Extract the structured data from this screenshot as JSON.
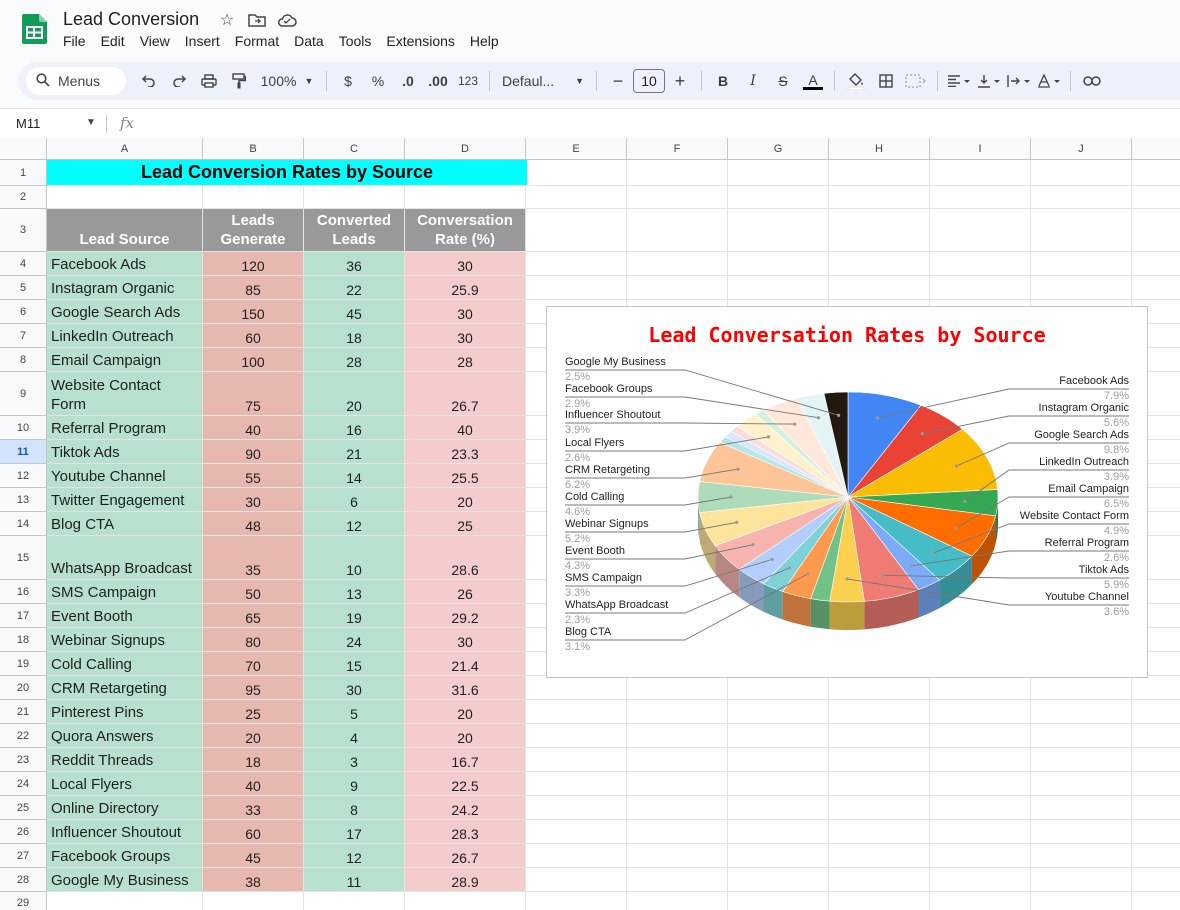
{
  "app": {
    "doc_title": "Lead Conversion",
    "menu": [
      "File",
      "Edit",
      "View",
      "Insert",
      "Format",
      "Data",
      "Tools",
      "Extensions",
      "Help"
    ]
  },
  "toolbar": {
    "search_label": "Menus",
    "zoom": "100%",
    "currency": "$",
    "percent": "%",
    "dec_decrease": ".0",
    "dec_increase": ".00",
    "number_format": "123",
    "font": "Defaul...",
    "font_size": "10",
    "bold": "B",
    "italic": "I",
    "strike": "S",
    "text_color": "A"
  },
  "formula_bar": {
    "cell_ref": "M11",
    "fx": "fx"
  },
  "grid": {
    "columns": [
      "A",
      "B",
      "C",
      "D",
      "E",
      "F",
      "G",
      "H",
      "I",
      "J"
    ],
    "rows": [
      "1",
      "2",
      "3",
      "4",
      "5",
      "6",
      "7",
      "8",
      "9",
      "10",
      "11",
      "12",
      "13",
      "14",
      "15",
      "16",
      "17",
      "18",
      "19",
      "20",
      "21",
      "22",
      "23",
      "24",
      "25",
      "26",
      "27",
      "28",
      "29"
    ],
    "selected_row": "11"
  },
  "sheet": {
    "title": "Lead Conversion Rates by Source",
    "headers": {
      "a": "Lead Source",
      "b": "Leads Generate",
      "c": "Converted Leads",
      "d": "Conversation Rate (%)"
    },
    "rows": [
      [
        "Facebook Ads",
        "120",
        "36",
        "30"
      ],
      [
        "Instagram Organic",
        "85",
        "22",
        "25.9"
      ],
      [
        "Google Search Ads",
        "150",
        "45",
        "30"
      ],
      [
        "LinkedIn Outreach",
        "60",
        "18",
        "30"
      ],
      [
        "Email Campaign",
        "100",
        "28",
        "28"
      ],
      [
        "Website Contact Form",
        "75",
        "20",
        "26.7"
      ],
      [
        "Referral Program",
        "40",
        "16",
        "40"
      ],
      [
        "Tiktok Ads",
        "90",
        "21",
        "23.3"
      ],
      [
        "Youtube Channel",
        "55",
        "14",
        "25.5"
      ],
      [
        "Twitter Engagement",
        "30",
        "6",
        "20"
      ],
      [
        "Blog CTA",
        "48",
        "12",
        "25"
      ],
      [
        "WhatsApp Broadcast",
        "35",
        "10",
        "28.6"
      ],
      [
        "SMS Campaign",
        "50",
        "13",
        "26"
      ],
      [
        "Event Booth",
        "65",
        "19",
        "29.2"
      ],
      [
        "Webinar Signups",
        "80",
        "24",
        "30"
      ],
      [
        "Cold Calling",
        "70",
        "15",
        "21.4"
      ],
      [
        "CRM Retargeting",
        "95",
        "30",
        "31.6"
      ],
      [
        "Pinterest Pins",
        "25",
        "5",
        "20"
      ],
      [
        "Quora Answers",
        "20",
        "4",
        "20"
      ],
      [
        "Reddit Threads",
        "18",
        "3",
        "16.7"
      ],
      [
        "Local Flyers",
        "40",
        "9",
        "22.5"
      ],
      [
        "Online Directory",
        "33",
        "8",
        "24.2"
      ],
      [
        "Influencer Shoutout",
        "60",
        "17",
        "28.3"
      ],
      [
        "Facebook Groups",
        "45",
        "12",
        "26.7"
      ],
      [
        "Google My Business",
        "38",
        "11",
        "28.9"
      ]
    ]
  },
  "chart_data": {
    "type": "pie",
    "title": "Lead Conversation Rates by Source",
    "title_color": "#ff0000",
    "style": "3d",
    "slices": [
      {
        "label": "Facebook Ads",
        "value": 7.9,
        "pct": "7.9%",
        "color": "#4285f4"
      },
      {
        "label": "Instagram Organic",
        "value": 5.6,
        "pct": "5.6%",
        "color": "#ea4335"
      },
      {
        "label": "Google Search Ads",
        "value": 9.8,
        "pct": "9.8%",
        "color": "#fbbc04"
      },
      {
        "label": "LinkedIn Outreach",
        "value": 3.9,
        "pct": "3.9%",
        "color": "#34a853"
      },
      {
        "label": "Email Campaign",
        "value": 6.5,
        "pct": "6.5%",
        "color": "#ff6d01"
      },
      {
        "label": "Website Contact Form",
        "value": 4.9,
        "pct": "4.9%",
        "color": "#46bdc6"
      },
      {
        "label": "Referral Program",
        "value": 2.6,
        "pct": "2.6%",
        "color": "#7baaf7"
      },
      {
        "label": "Tiktok Ads",
        "value": 5.9,
        "pct": "5.9%",
        "color": "#f07b72"
      },
      {
        "label": "Youtube Channel",
        "value": 3.6,
        "pct": "3.6%",
        "color": "#fcd04f"
      },
      {
        "label": "Twitter Engagement",
        "value": 2.0,
        "pct": "",
        "color": "#71c287"
      },
      {
        "label": "Blog CTA",
        "value": 3.1,
        "pct": "3.1%",
        "color": "#ff994d"
      },
      {
        "label": "WhatsApp Broadcast",
        "value": 2.3,
        "pct": "2.3%",
        "color": "#7ed1d7"
      },
      {
        "label": "SMS Campaign",
        "value": 3.3,
        "pct": "3.3%",
        "color": "#b3cefb"
      },
      {
        "label": "Event Booth",
        "value": 4.3,
        "pct": "4.3%",
        "color": "#f7b4ae"
      },
      {
        "label": "Webinar Signups",
        "value": 5.2,
        "pct": "5.2%",
        "color": "#fde49b"
      },
      {
        "label": "Cold Calling",
        "value": 4.6,
        "pct": "4.6%",
        "color": "#aedcba"
      },
      {
        "label": "CRM Retargeting",
        "value": 6.2,
        "pct": "6.2%",
        "color": "#ffc599"
      },
      {
        "label": "Pinterest Pins",
        "value": 1.0,
        "pct": "",
        "color": "#b5e5e8"
      },
      {
        "label": "Quora Answers",
        "value": 1.0,
        "pct": "",
        "color": "#d9e6fd"
      },
      {
        "label": "Reddit Threads",
        "value": 1.0,
        "pct": "",
        "color": "#fadcd9"
      },
      {
        "label": "Local Flyers",
        "value": 2.6,
        "pct": "2.6%",
        "color": "#fef2cd"
      },
      {
        "label": "Online Directory",
        "value": 1.0,
        "pct": "",
        "color": "#d7f0dd"
      },
      {
        "label": "Influencer Shoutout",
        "value": 3.9,
        "pct": "3.9%",
        "color": "#ffe8d9"
      },
      {
        "label": "Facebook Groups",
        "value": 2.9,
        "pct": "2.9%",
        "color": "#e3f4f6"
      },
      {
        "label": "Google My Business",
        "value": 2.5,
        "pct": "2.5%",
        "color": "#231a0f"
      }
    ],
    "labeled_left": [
      "Google My Business",
      "Facebook Groups",
      "Influencer Shoutout",
      "Local Flyers",
      "CRM Retargeting",
      "Cold Calling",
      "Webinar Signups",
      "Event Booth",
      "SMS Campaign",
      "WhatsApp Broadcast",
      "Blog CTA"
    ],
    "labeled_right": [
      "Facebook Ads",
      "Instagram Organic",
      "Google Search Ads",
      "LinkedIn Outreach",
      "Email Campaign",
      "Website Contact Form",
      "Referral Program",
      "Tiktok Ads",
      "Youtube Channel"
    ]
  }
}
